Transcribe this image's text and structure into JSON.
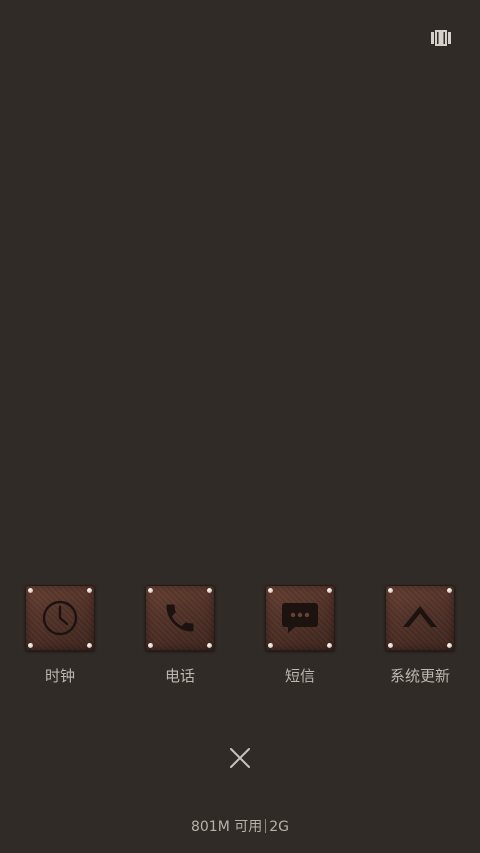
{
  "status": {
    "top_right_icon": "recents-view-icon"
  },
  "apps": [
    {
      "label": "时钟",
      "icon": "clock-icon"
    },
    {
      "label": "电话",
      "icon": "phone-icon"
    },
    {
      "label": "短信",
      "icon": "message-icon"
    },
    {
      "label": "系统更新",
      "icon": "chevron-up-icon"
    }
  ],
  "close": {
    "icon": "close-icon"
  },
  "memory": {
    "available": "801M 可用",
    "total": "2G"
  },
  "colors": {
    "background": "#302b27",
    "tile_leather": "#533329",
    "icon_dark": "#1c1311",
    "label_text": "#bdb6ae"
  }
}
